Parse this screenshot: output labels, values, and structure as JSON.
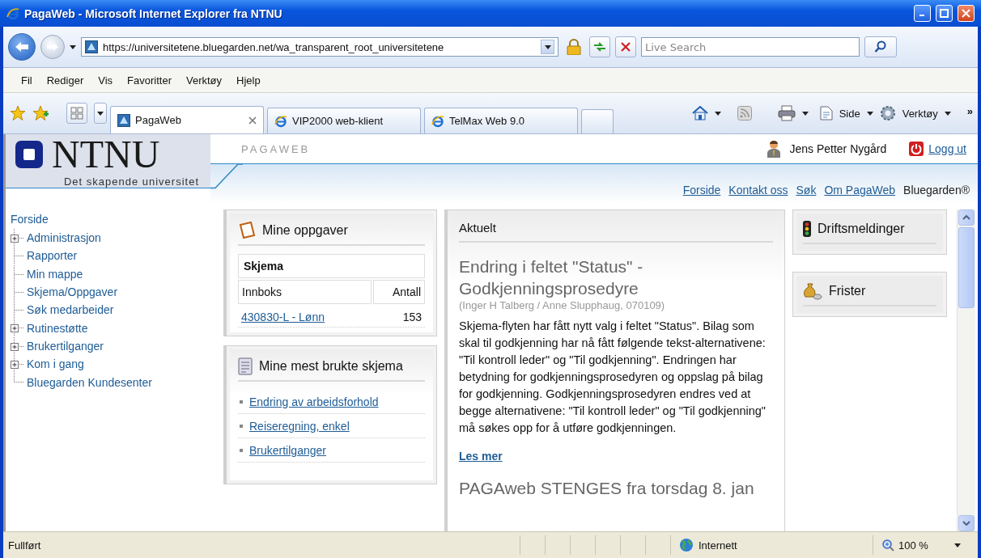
{
  "window": {
    "title": "PagaWeb - Microsoft Internet Explorer fra NTNU"
  },
  "address_bar": {
    "url": "https://universitetene.bluegarden.net/wa_transparent_root_universitetene",
    "search_placeholder": "Live Search"
  },
  "menu": [
    "Fil",
    "Rediger",
    "Vis",
    "Favoritter",
    "Verktøy",
    "Hjelp"
  ],
  "tabs": [
    {
      "label": "PagaWeb",
      "selected": true
    },
    {
      "label": "VIP2000 web-klient",
      "selected": false
    },
    {
      "label": "TelMax Web 9.0",
      "selected": false
    }
  ],
  "command_bar": {
    "page": "Side",
    "tools": "Verktøy",
    "more": "»"
  },
  "header": {
    "logo": "NTNU",
    "tagline": "Det skapende universitet",
    "app_name": "PAGAWEB",
    "user": "Jens Petter Nygård",
    "logout": "Logg ut",
    "links": [
      "Forside",
      "Kontakt oss",
      "Søk",
      "Om PagaWeb"
    ],
    "brand": "Bluegarden®"
  },
  "nav": {
    "root": "Forside",
    "items": [
      {
        "label": "Administrasjon",
        "kind": "group"
      },
      {
        "label": "Rapporter",
        "kind": "leaf"
      },
      {
        "label": "Min mappe",
        "kind": "leaf"
      },
      {
        "label": "Skjema/Oppgaver",
        "kind": "leaf"
      },
      {
        "label": "Søk medarbeider",
        "kind": "leaf"
      },
      {
        "label": "Rutinestøtte",
        "kind": "group"
      },
      {
        "label": "Brukertilganger",
        "kind": "group"
      },
      {
        "label": "Kom i gang",
        "kind": "group"
      },
      {
        "label": "Bluegarden Kundesenter",
        "kind": "leaf"
      }
    ]
  },
  "tasks": {
    "title": "Mine oppgaver",
    "group": "Skjema",
    "columns": [
      "Innboks",
      "Antall"
    ],
    "rows": [
      {
        "form": "430830-L - Lønn",
        "count": "153"
      }
    ]
  },
  "favorites": {
    "title": "Mine mest brukte skjema",
    "links": [
      "Endring av arbeidsforhold",
      "Reiseregning, enkel",
      "Brukertilganger"
    ]
  },
  "news": {
    "title": "Aktuelt",
    "articles": [
      {
        "headline": "Endring i feltet \"Status\" - Godkjenningsprosedyre",
        "byline": "(Inger H Talberg / Anne Slupphaug, 070109)",
        "body": "Skjema-flyten har fått nytt valg i feltet \"Status\". Bilag som skal til godkjenning har nå fått følgende tekst-alternativene: \"Til kontroll leder\" og \"Til godkjenning\". Endringen har betydning for godkjenningsprosedyren og oppslag på bilag for godkjenning. Godkjenningsprosedyren endres ved at begge alternativene: \"Til kontroll leder\" og \"Til godkjenning\" må søkes opp for å utføre godkjenningen.",
        "more": "Les mer"
      },
      {
        "headline": "PAGAweb STENGES fra torsdag 8. jan"
      }
    ]
  },
  "side_panels": [
    {
      "title": "Driftsmeldinger",
      "kind": "traffic"
    },
    {
      "title": "Frister",
      "kind": "moneybag"
    }
  ],
  "status_bar": {
    "text": "Fullført",
    "zone": "Internett",
    "zoom": "100 %"
  }
}
